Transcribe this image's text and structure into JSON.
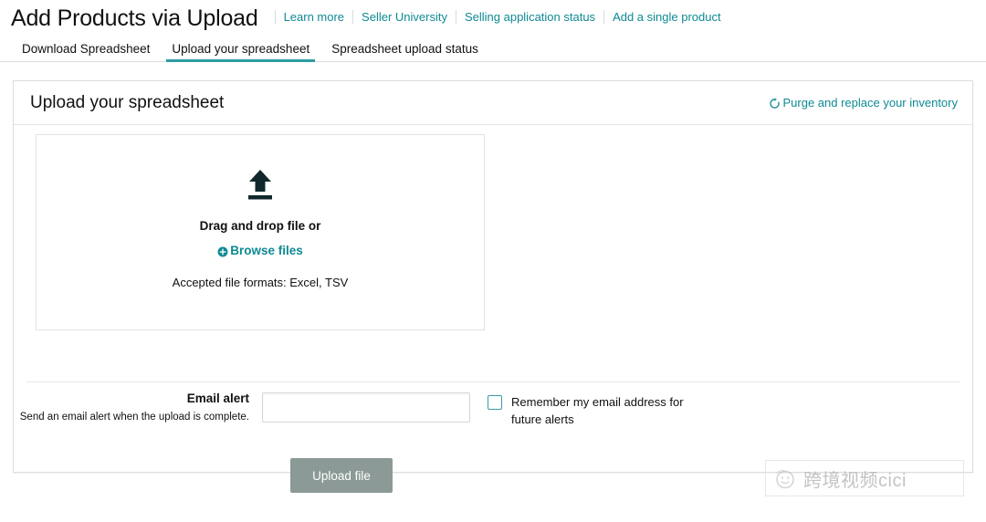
{
  "header": {
    "title": "Add Products via Upload",
    "links": [
      {
        "label": "Learn more"
      },
      {
        "label": "Seller University"
      },
      {
        "label": "Selling application status"
      },
      {
        "label": "Add a single product"
      }
    ]
  },
  "tabs": [
    {
      "label": "Download Spreadsheet",
      "active": false
    },
    {
      "label": "Upload your spreadsheet",
      "active": true
    },
    {
      "label": "Spreadsheet upload status",
      "active": false
    }
  ],
  "card": {
    "title": "Upload your spreadsheet",
    "purge_link": "Purge and replace your inventory",
    "purge_icon": "refresh-icon"
  },
  "dropzone": {
    "upload_icon": "upload-arrow-icon",
    "title": "Drag and drop file or",
    "browse_label": "Browse files",
    "browse_icon": "plus-circle-icon",
    "formats": "Accepted file formats: Excel, TSV"
  },
  "email": {
    "label": "Email alert",
    "help": "Send an email alert when the upload is complete.",
    "value": "",
    "placeholder": "",
    "remember_label": "Remember my email address for future alerts",
    "remember_checked": false
  },
  "actions": {
    "upload_label": "Upload file"
  },
  "watermark": {
    "text": "跨境视频cici",
    "logo_icon": "smiley-face-icon"
  },
  "colors": {
    "link_teal": "#0f8a94",
    "tab_active_underline": "#2e9ba4",
    "checkbox_border": "#3a9ba3",
    "button_disabled_bg": "#8b9a96",
    "icon_dark": "#0f2b2e"
  }
}
